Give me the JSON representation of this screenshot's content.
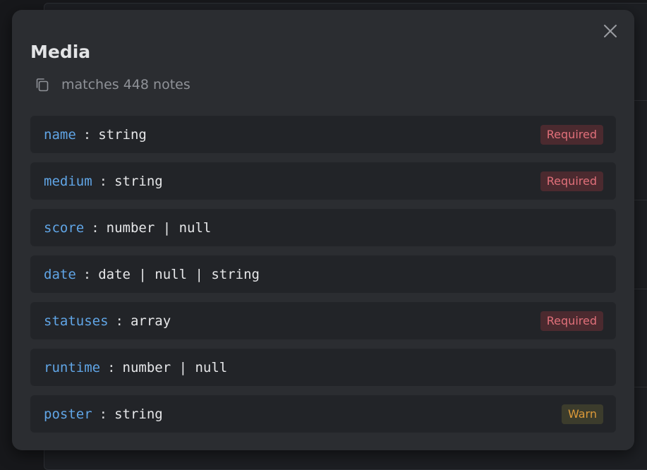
{
  "modal": {
    "title": "Media",
    "subtitle": "matches 448 notes",
    "close_icon": "close-icon",
    "copy_icon": "copy-icon"
  },
  "fields": [
    {
      "name": "name",
      "type": "string",
      "badge": "Required",
      "badge_kind": "required"
    },
    {
      "name": "medium",
      "type": "string",
      "badge": "Required",
      "badge_kind": "required"
    },
    {
      "name": "score",
      "type": "number | null",
      "badge": "",
      "badge_kind": ""
    },
    {
      "name": "date",
      "type": "date | null | string",
      "badge": "",
      "badge_kind": ""
    },
    {
      "name": "statuses",
      "type": "array",
      "badge": "Required",
      "badge_kind": "required"
    },
    {
      "name": "runtime",
      "type": "number | null",
      "badge": "",
      "badge_kind": ""
    },
    {
      "name": "poster",
      "type": "string",
      "badge": "Warn",
      "badge_kind": "warn"
    }
  ],
  "separator": ":",
  "colors": {
    "field_name": "#60a5e6",
    "required_bg": "#4b2a2f",
    "required_text": "#e1707a",
    "warn_bg": "#3c3c2c",
    "warn_text": "#dc9a39",
    "modal_bg": "#2b2d31",
    "row_bg": "#222428"
  }
}
